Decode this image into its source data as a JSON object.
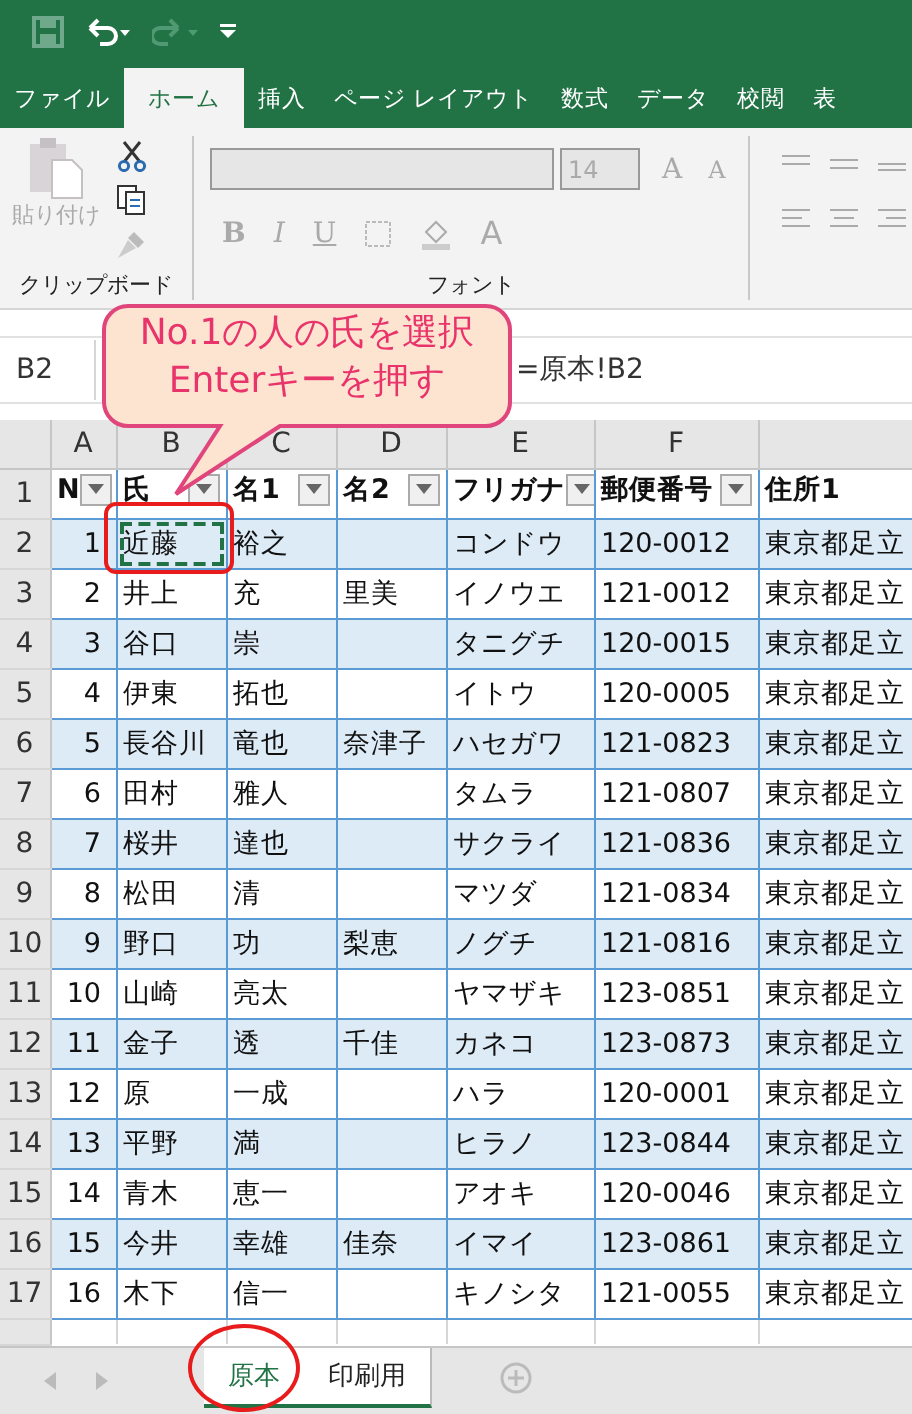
{
  "ribbon_tabs": [
    {
      "label": "ファイル",
      "selected": false
    },
    {
      "label": "ホーム",
      "selected": true
    },
    {
      "label": "挿入",
      "selected": false
    },
    {
      "label": "ページ レイアウト",
      "selected": false
    },
    {
      "label": "数式",
      "selected": false
    },
    {
      "label": "データ",
      "selected": false
    },
    {
      "label": "校閲",
      "selected": false
    },
    {
      "label": "表",
      "selected": false
    }
  ],
  "clipboard": {
    "paste_label": "貼り付け",
    "group_label": "クリップボード"
  },
  "font": {
    "size": "14",
    "grow": "A",
    "shrink": "A",
    "styles": [
      "B",
      "I",
      "U"
    ],
    "color_letter": "A",
    "group_label": "フォント"
  },
  "formula_bar": {
    "name_box": "B2",
    "formula": "=原本!B2"
  },
  "callout": {
    "lines": [
      "No.1の人の氏を選択",
      "Enterキーを押す"
    ]
  },
  "columns": [
    "A",
    "B",
    "C",
    "D",
    "E",
    "F"
  ],
  "header_row_number": "1",
  "headers": [
    "N",
    "氏",
    "名1",
    "名2",
    "フリガナ",
    "郵便番号",
    "住所1"
  ],
  "rows": [
    {
      "number": "2",
      "marquee": true,
      "cells": [
        "1",
        "近藤",
        "裕之",
        "",
        "コンドウ",
        "120-0012",
        "東京都足立"
      ]
    },
    {
      "number": "3",
      "marquee": false,
      "cells": [
        "2",
        "井上",
        "充",
        "里美",
        "イノウエ",
        "121-0012",
        "東京都足立"
      ]
    },
    {
      "number": "4",
      "marquee": false,
      "cells": [
        "3",
        "谷口",
        "崇",
        "",
        "タニグチ",
        "120-0015",
        "東京都足立"
      ]
    },
    {
      "number": "5",
      "marquee": false,
      "cells": [
        "4",
        "伊東",
        "拓也",
        "",
        "イトウ",
        "120-0005",
        "東京都足立"
      ]
    },
    {
      "number": "6",
      "marquee": false,
      "cells": [
        "5",
        "長谷川",
        "竜也",
        "奈津子",
        "ハセガワ",
        "121-0823",
        "東京都足立"
      ]
    },
    {
      "number": "7",
      "marquee": false,
      "cells": [
        "6",
        "田村",
        "雅人",
        "",
        "タムラ",
        "121-0807",
        "東京都足立"
      ]
    },
    {
      "number": "8",
      "marquee": false,
      "cells": [
        "7",
        "桜井",
        "達也",
        "",
        "サクライ",
        "121-0836",
        "東京都足立"
      ]
    },
    {
      "number": "9",
      "marquee": false,
      "cells": [
        "8",
        "松田",
        "清",
        "",
        "マツダ",
        "121-0834",
        "東京都足立"
      ]
    },
    {
      "number": "10",
      "marquee": false,
      "cells": [
        "9",
        "野口",
        "功",
        "梨恵",
        "ノグチ",
        "121-0816",
        "東京都足立"
      ]
    },
    {
      "number": "11",
      "marquee": false,
      "cells": [
        "10",
        "山崎",
        "亮太",
        "",
        "ヤマザキ",
        "123-0851",
        "東京都足立"
      ]
    },
    {
      "number": "12",
      "marquee": false,
      "cells": [
        "11",
        "金子",
        "透",
        "千佳",
        "カネコ",
        "123-0873",
        "東京都足立"
      ]
    },
    {
      "number": "13",
      "marquee": false,
      "cells": [
        "12",
        "原",
        "一成",
        "",
        "ハラ",
        "120-0001",
        "東京都足立"
      ]
    },
    {
      "number": "14",
      "marquee": false,
      "cells": [
        "13",
        "平野",
        "満",
        "",
        "ヒラノ",
        "123-0844",
        "東京都足立"
      ]
    },
    {
      "number": "15",
      "marquee": false,
      "cells": [
        "14",
        "青木",
        "恵一",
        "",
        "アオキ",
        "120-0046",
        "東京都足立"
      ]
    },
    {
      "number": "16",
      "marquee": false,
      "cells": [
        "15",
        "今井",
        "幸雄",
        "佳奈",
        "イマイ",
        "123-0861",
        "東京都足立"
      ]
    },
    {
      "number": "17",
      "marquee": false,
      "cells": [
        "16",
        "木下",
        "信一",
        "",
        "キノシタ",
        "121-0055",
        "東京都足立"
      ]
    }
  ],
  "sheet_tabs": [
    {
      "label": "原本",
      "selected": true
    },
    {
      "label": "印刷用",
      "selected": false
    }
  ]
}
